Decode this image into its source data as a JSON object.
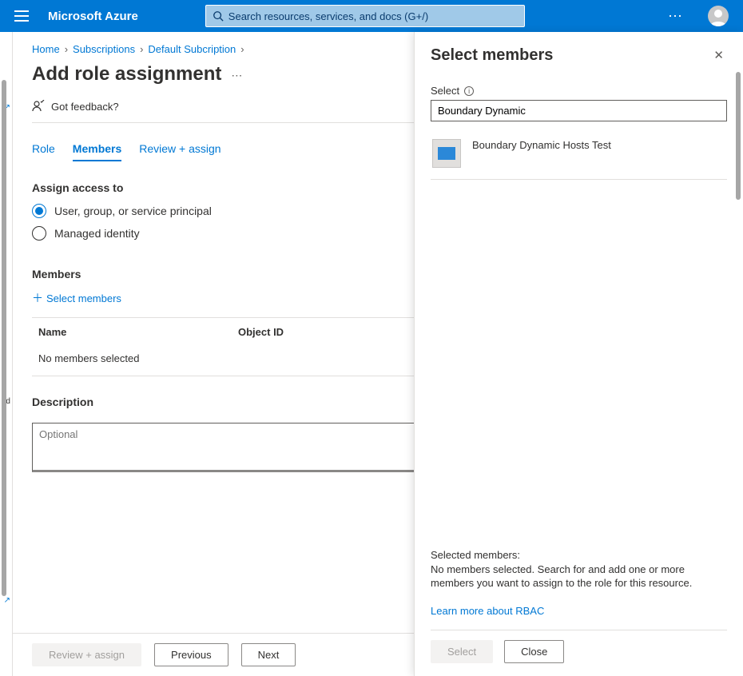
{
  "header": {
    "brand": "Microsoft Azure",
    "search_placeholder": "Search resources, services, and docs (G+/)"
  },
  "breadcrumb": {
    "items": [
      "Home",
      "Subscriptions",
      "Default Subcription"
    ]
  },
  "page": {
    "title": "Add role assignment",
    "feedback_label": "Got feedback?"
  },
  "tabs": {
    "role": "Role",
    "members": "Members",
    "review": "Review + assign"
  },
  "assign": {
    "section_label": "Assign access to",
    "opt1": "User, group, or service principal",
    "opt2": "Managed identity"
  },
  "members": {
    "section_label": "Members",
    "select_link": "Select members",
    "col_name": "Name",
    "col_objectid": "Object ID",
    "empty": "No members selected"
  },
  "description": {
    "label": "Description",
    "placeholder": "Optional"
  },
  "footer": {
    "review": "Review + assign",
    "previous": "Previous",
    "next": "Next"
  },
  "panel": {
    "title": "Select members",
    "select_label": "Select",
    "search_value": "Boundary Dynamic",
    "result_label": "Boundary Dynamic Hosts Test",
    "selected_heading": "Selected members:",
    "selected_msg": "No members selected. Search for and add one or more members you want to assign to the role for this resource.",
    "learn_link": "Learn more about RBAC",
    "btn_select": "Select",
    "btn_close": "Close"
  },
  "left_sliver": {
    "a": "",
    "b": "",
    "c": "nd",
    "d": ""
  }
}
